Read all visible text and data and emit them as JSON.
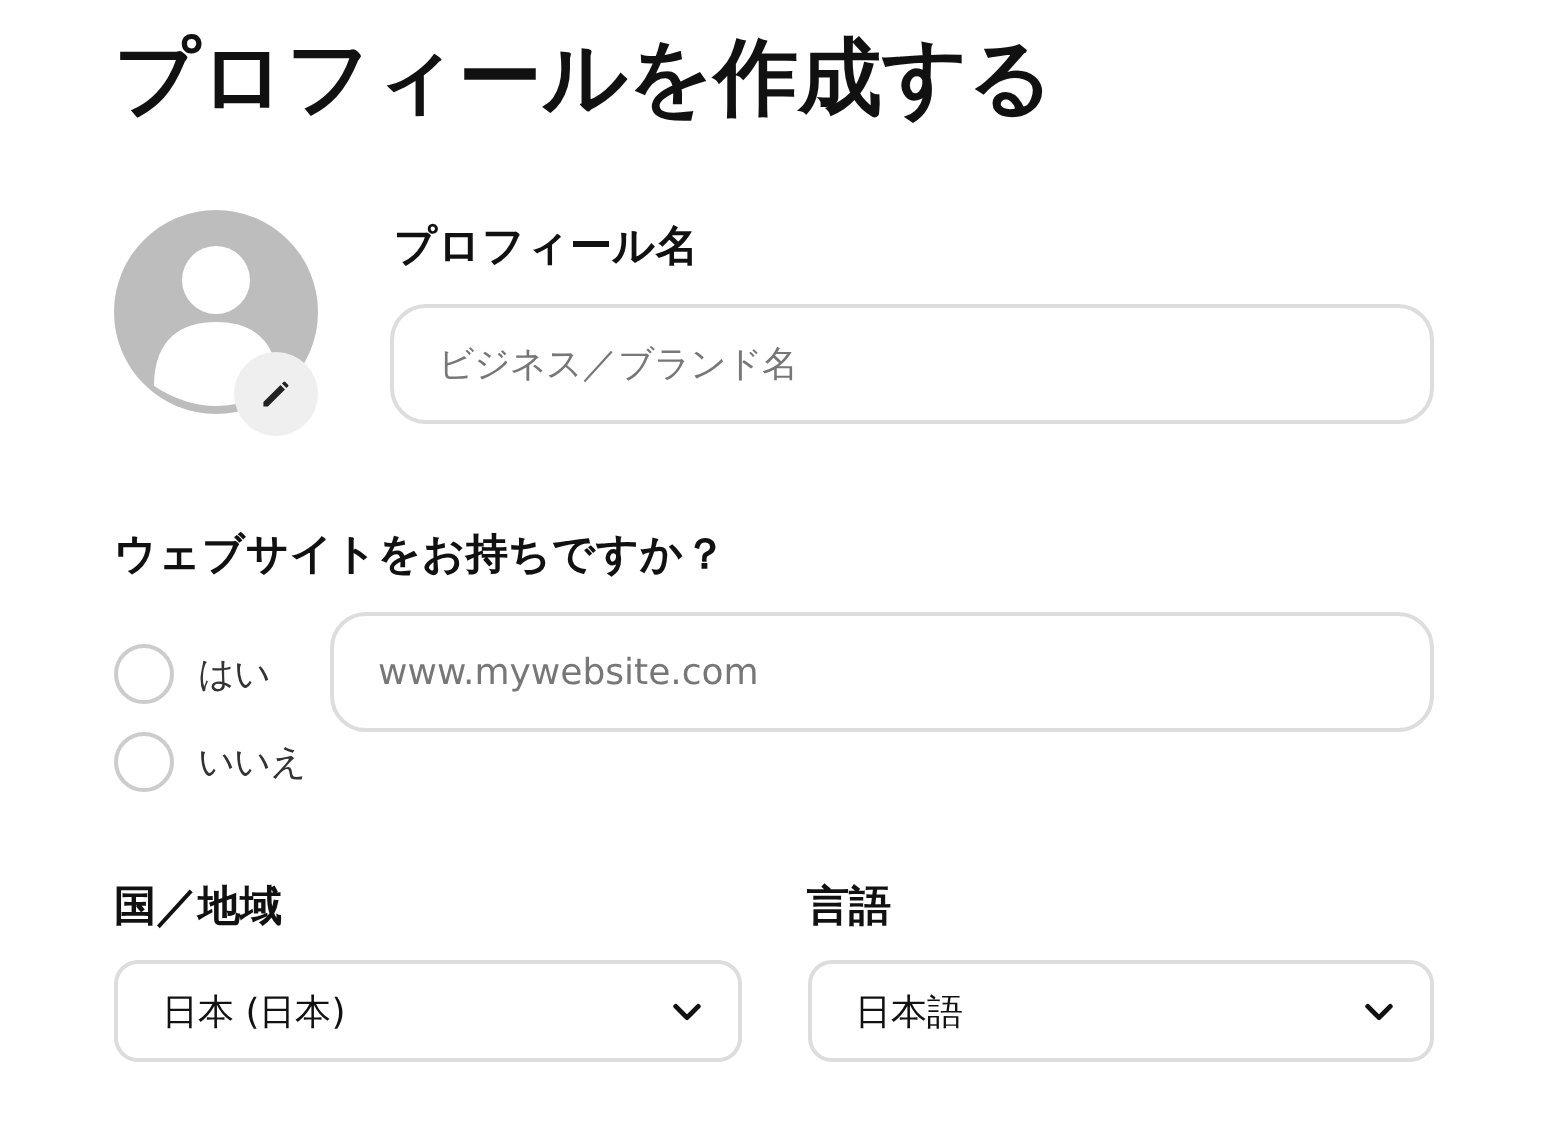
{
  "title": "プロフィールを作成する",
  "profile_name": {
    "label": "プロフィール名",
    "placeholder": "ビジネス／ブランド名"
  },
  "website": {
    "question": "ウェブサイトをお持ちですか？",
    "options": [
      {
        "label": "はい",
        "selected": false
      },
      {
        "label": "いいえ",
        "selected": false
      }
    ],
    "placeholder": "www.mywebsite.com"
  },
  "selects": [
    {
      "label": "国／地域",
      "value": "日本 (日本)"
    },
    {
      "label": "言語",
      "value": "日本語"
    }
  ]
}
